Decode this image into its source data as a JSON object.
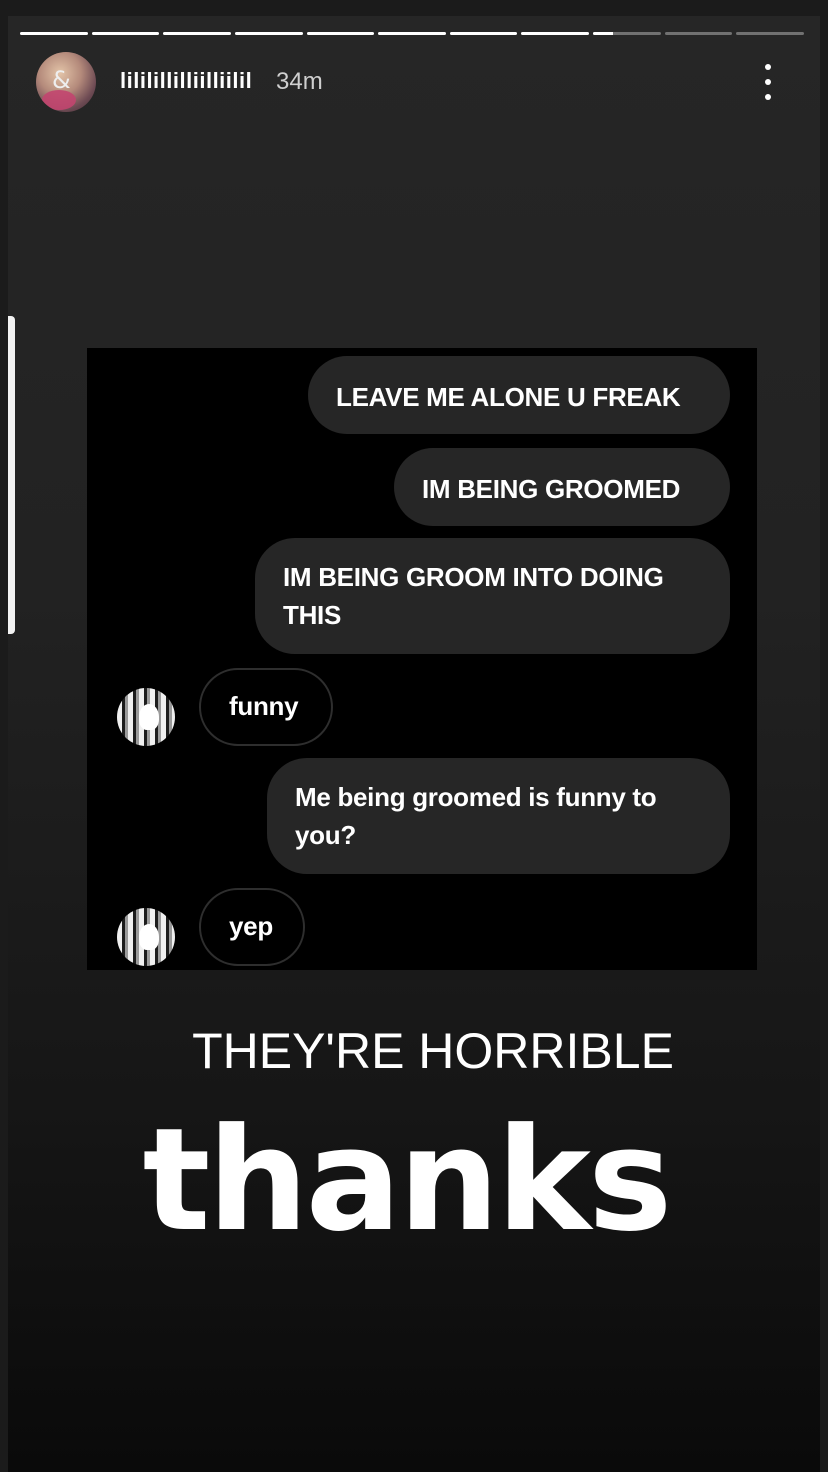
{
  "story": {
    "progress": {
      "total_segments": 11,
      "completed_segments": 8,
      "current_segment_progress": 0.3
    },
    "header": {
      "username": "lililillilliilliilil",
      "time_ago": "34m",
      "more_icon": "more-vertical-icon"
    },
    "chat_screenshot": {
      "messages": [
        {
          "from": "me",
          "text": "LEAVE ME ALONE U FREAK"
        },
        {
          "from": "me",
          "text": "IM BEING GROOMED"
        },
        {
          "from": "me",
          "text": "IM BEING GROOM INTO DOING THIS"
        },
        {
          "from": "them",
          "text": "funny"
        },
        {
          "from": "me",
          "text": "Me being groomed is funny to you?"
        },
        {
          "from": "them",
          "text": "yep"
        }
      ],
      "colors": {
        "background": "#000000",
        "outgoing_bubble": "#262626",
        "incoming_border": "#2e2e2e"
      }
    },
    "caption": "THEY'RE HORRIBLE",
    "sticker_text": "thanks"
  }
}
